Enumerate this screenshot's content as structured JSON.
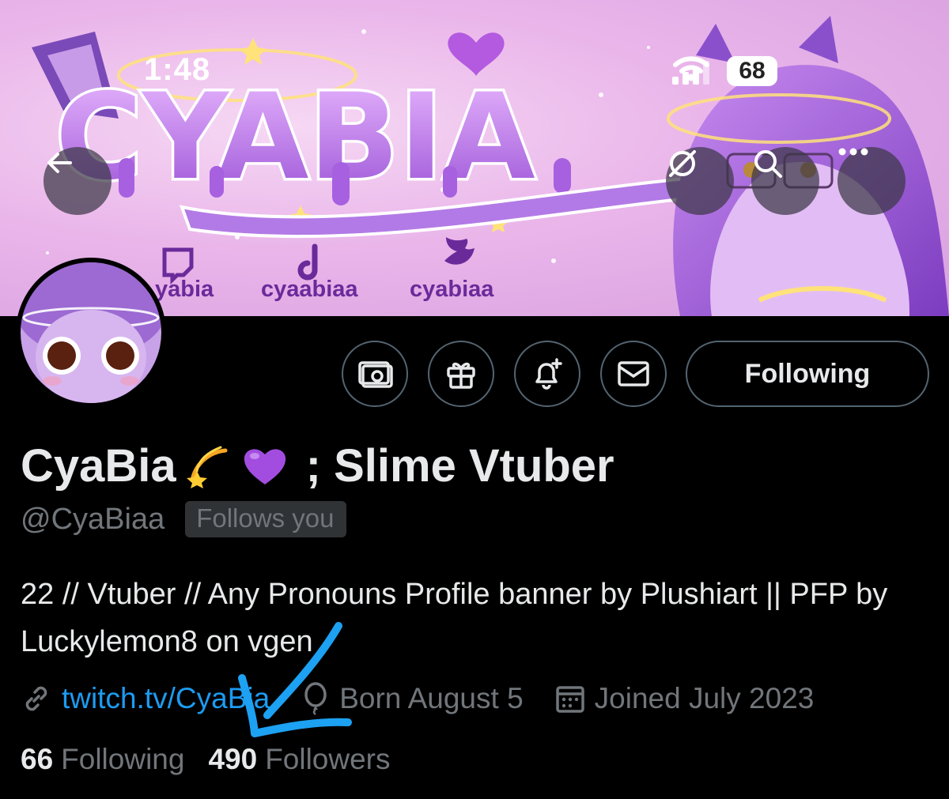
{
  "status_bar": {
    "time": "1:48",
    "battery": "68"
  },
  "banner": {
    "logo_text": "CYABIA",
    "socials": [
      {
        "platform_icon": "twitch-icon",
        "label": "yabia"
      },
      {
        "platform_icon": "tiktok-icon",
        "label": "cyaabiaa"
      },
      {
        "platform_icon": "twitter-bird-icon",
        "label": "cyabiaa"
      }
    ]
  },
  "nav": {
    "back_icon": "arrow-left-icon",
    "grok_icon": "grok-icon",
    "search_icon": "search-icon",
    "more_icon": "more-horizontal-icon"
  },
  "actions": {
    "tip_icon": "money-icon",
    "gift_icon": "gift-icon",
    "notify_icon": "bell-plus-icon",
    "message_icon": "mail-icon",
    "following_label": "Following"
  },
  "profile": {
    "name": "CyaBia",
    "name_emojis": [
      "💫",
      "💜"
    ],
    "name_suffix": "; Slime Vtuber",
    "handle": "@CyaBiaa",
    "follows_you": "Follows you",
    "bio": "22 // Vtuber // Any Pronouns Profile banner by Plushiart || PFP by Luckylemon8 on vgen",
    "website": "twitch.tv/CyaBia",
    "birthday": "Born August 5",
    "joined": "Joined July 2023",
    "following_count": "66",
    "following_label": "Following",
    "followers_count": "490",
    "followers_label": "Followers"
  },
  "colors": {
    "accent": "#1d9bf0",
    "muted": "#71767b",
    "text": "#e7e9ea",
    "banner_purple": "#b070e0",
    "annotation": "#1da1f2"
  }
}
